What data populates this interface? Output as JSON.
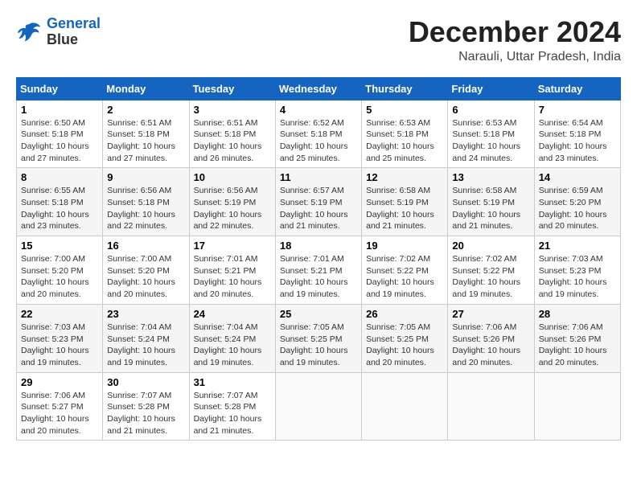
{
  "header": {
    "logo_line1": "General",
    "logo_line2": "Blue",
    "month": "December 2024",
    "location": "Narauli, Uttar Pradesh, India"
  },
  "weekdays": [
    "Sunday",
    "Monday",
    "Tuesday",
    "Wednesday",
    "Thursday",
    "Friday",
    "Saturday"
  ],
  "weeks": [
    [
      {
        "day": "1",
        "sunrise": "6:50 AM",
        "sunset": "5:18 PM",
        "daylight": "10 hours and 27 minutes."
      },
      {
        "day": "2",
        "sunrise": "6:51 AM",
        "sunset": "5:18 PM",
        "daylight": "10 hours and 27 minutes."
      },
      {
        "day": "3",
        "sunrise": "6:51 AM",
        "sunset": "5:18 PM",
        "daylight": "10 hours and 26 minutes."
      },
      {
        "day": "4",
        "sunrise": "6:52 AM",
        "sunset": "5:18 PM",
        "daylight": "10 hours and 25 minutes."
      },
      {
        "day": "5",
        "sunrise": "6:53 AM",
        "sunset": "5:18 PM",
        "daylight": "10 hours and 25 minutes."
      },
      {
        "day": "6",
        "sunrise": "6:53 AM",
        "sunset": "5:18 PM",
        "daylight": "10 hours and 24 minutes."
      },
      {
        "day": "7",
        "sunrise": "6:54 AM",
        "sunset": "5:18 PM",
        "daylight": "10 hours and 23 minutes."
      }
    ],
    [
      {
        "day": "8",
        "sunrise": "6:55 AM",
        "sunset": "5:18 PM",
        "daylight": "10 hours and 23 minutes."
      },
      {
        "day": "9",
        "sunrise": "6:56 AM",
        "sunset": "5:18 PM",
        "daylight": "10 hours and 22 minutes."
      },
      {
        "day": "10",
        "sunrise": "6:56 AM",
        "sunset": "5:19 PM",
        "daylight": "10 hours and 22 minutes."
      },
      {
        "day": "11",
        "sunrise": "6:57 AM",
        "sunset": "5:19 PM",
        "daylight": "10 hours and 21 minutes."
      },
      {
        "day": "12",
        "sunrise": "6:58 AM",
        "sunset": "5:19 PM",
        "daylight": "10 hours and 21 minutes."
      },
      {
        "day": "13",
        "sunrise": "6:58 AM",
        "sunset": "5:19 PM",
        "daylight": "10 hours and 21 minutes."
      },
      {
        "day": "14",
        "sunrise": "6:59 AM",
        "sunset": "5:20 PM",
        "daylight": "10 hours and 20 minutes."
      }
    ],
    [
      {
        "day": "15",
        "sunrise": "7:00 AM",
        "sunset": "5:20 PM",
        "daylight": "10 hours and 20 minutes."
      },
      {
        "day": "16",
        "sunrise": "7:00 AM",
        "sunset": "5:20 PM",
        "daylight": "10 hours and 20 minutes."
      },
      {
        "day": "17",
        "sunrise": "7:01 AM",
        "sunset": "5:21 PM",
        "daylight": "10 hours and 20 minutes."
      },
      {
        "day": "18",
        "sunrise": "7:01 AM",
        "sunset": "5:21 PM",
        "daylight": "10 hours and 19 minutes."
      },
      {
        "day": "19",
        "sunrise": "7:02 AM",
        "sunset": "5:22 PM",
        "daylight": "10 hours and 19 minutes."
      },
      {
        "day": "20",
        "sunrise": "7:02 AM",
        "sunset": "5:22 PM",
        "daylight": "10 hours and 19 minutes."
      },
      {
        "day": "21",
        "sunrise": "7:03 AM",
        "sunset": "5:23 PM",
        "daylight": "10 hours and 19 minutes."
      }
    ],
    [
      {
        "day": "22",
        "sunrise": "7:03 AM",
        "sunset": "5:23 PM",
        "daylight": "10 hours and 19 minutes."
      },
      {
        "day": "23",
        "sunrise": "7:04 AM",
        "sunset": "5:24 PM",
        "daylight": "10 hours and 19 minutes."
      },
      {
        "day": "24",
        "sunrise": "7:04 AM",
        "sunset": "5:24 PM",
        "daylight": "10 hours and 19 minutes."
      },
      {
        "day": "25",
        "sunrise": "7:05 AM",
        "sunset": "5:25 PM",
        "daylight": "10 hours and 19 minutes."
      },
      {
        "day": "26",
        "sunrise": "7:05 AM",
        "sunset": "5:25 PM",
        "daylight": "10 hours and 20 minutes."
      },
      {
        "day": "27",
        "sunrise": "7:06 AM",
        "sunset": "5:26 PM",
        "daylight": "10 hours and 20 minutes."
      },
      {
        "day": "28",
        "sunrise": "7:06 AM",
        "sunset": "5:26 PM",
        "daylight": "10 hours and 20 minutes."
      }
    ],
    [
      {
        "day": "29",
        "sunrise": "7:06 AM",
        "sunset": "5:27 PM",
        "daylight": "10 hours and 20 minutes."
      },
      {
        "day": "30",
        "sunrise": "7:07 AM",
        "sunset": "5:28 PM",
        "daylight": "10 hours and 21 minutes."
      },
      {
        "day": "31",
        "sunrise": "7:07 AM",
        "sunset": "5:28 PM",
        "daylight": "10 hours and 21 minutes."
      },
      null,
      null,
      null,
      null
    ]
  ]
}
